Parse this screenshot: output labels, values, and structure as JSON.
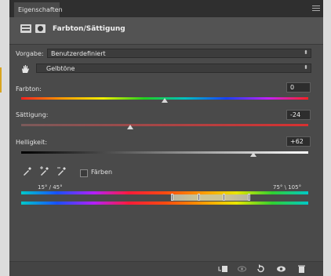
{
  "panel": {
    "tab_label": "Eigenschaften",
    "title": "Farbton/Sättigung"
  },
  "preset": {
    "label": "Vorgabe:",
    "value": "Benutzerdefiniert"
  },
  "channel": {
    "value": "Gelbtöne"
  },
  "hue": {
    "label": "Farbton:",
    "value": "0",
    "level": 0.5
  },
  "saturation": {
    "label": "Sättigung:",
    "value": "-24",
    "level": 0.38
  },
  "lightness": {
    "label": "Helligkeit:",
    "value": "+62",
    "level": 0.81
  },
  "colorize": {
    "label": "Färben",
    "checked": false
  },
  "range": {
    "left_label": "15° / 45°",
    "right_label": "75° \\ 105°"
  },
  "icons": {
    "adjustment": "adjustment-layer-icon",
    "mask": "mask-icon",
    "hand": "targeted-adjustment-hand-icon",
    "eyedropper": "eyedropper-icon",
    "eyedropper_add": "eyedropper-plus-icon",
    "eyedropper_sub": "eyedropper-minus-icon",
    "clip": "clip-to-layer-icon",
    "view_previous": "view-previous-icon",
    "reset": "reset-icon",
    "visibility": "eye-icon",
    "delete": "trash-icon"
  },
  "colors": {
    "panel_bg": "#4a4a4a",
    "header_bg": "#535353",
    "tab_bar": "#2f2f2f"
  }
}
